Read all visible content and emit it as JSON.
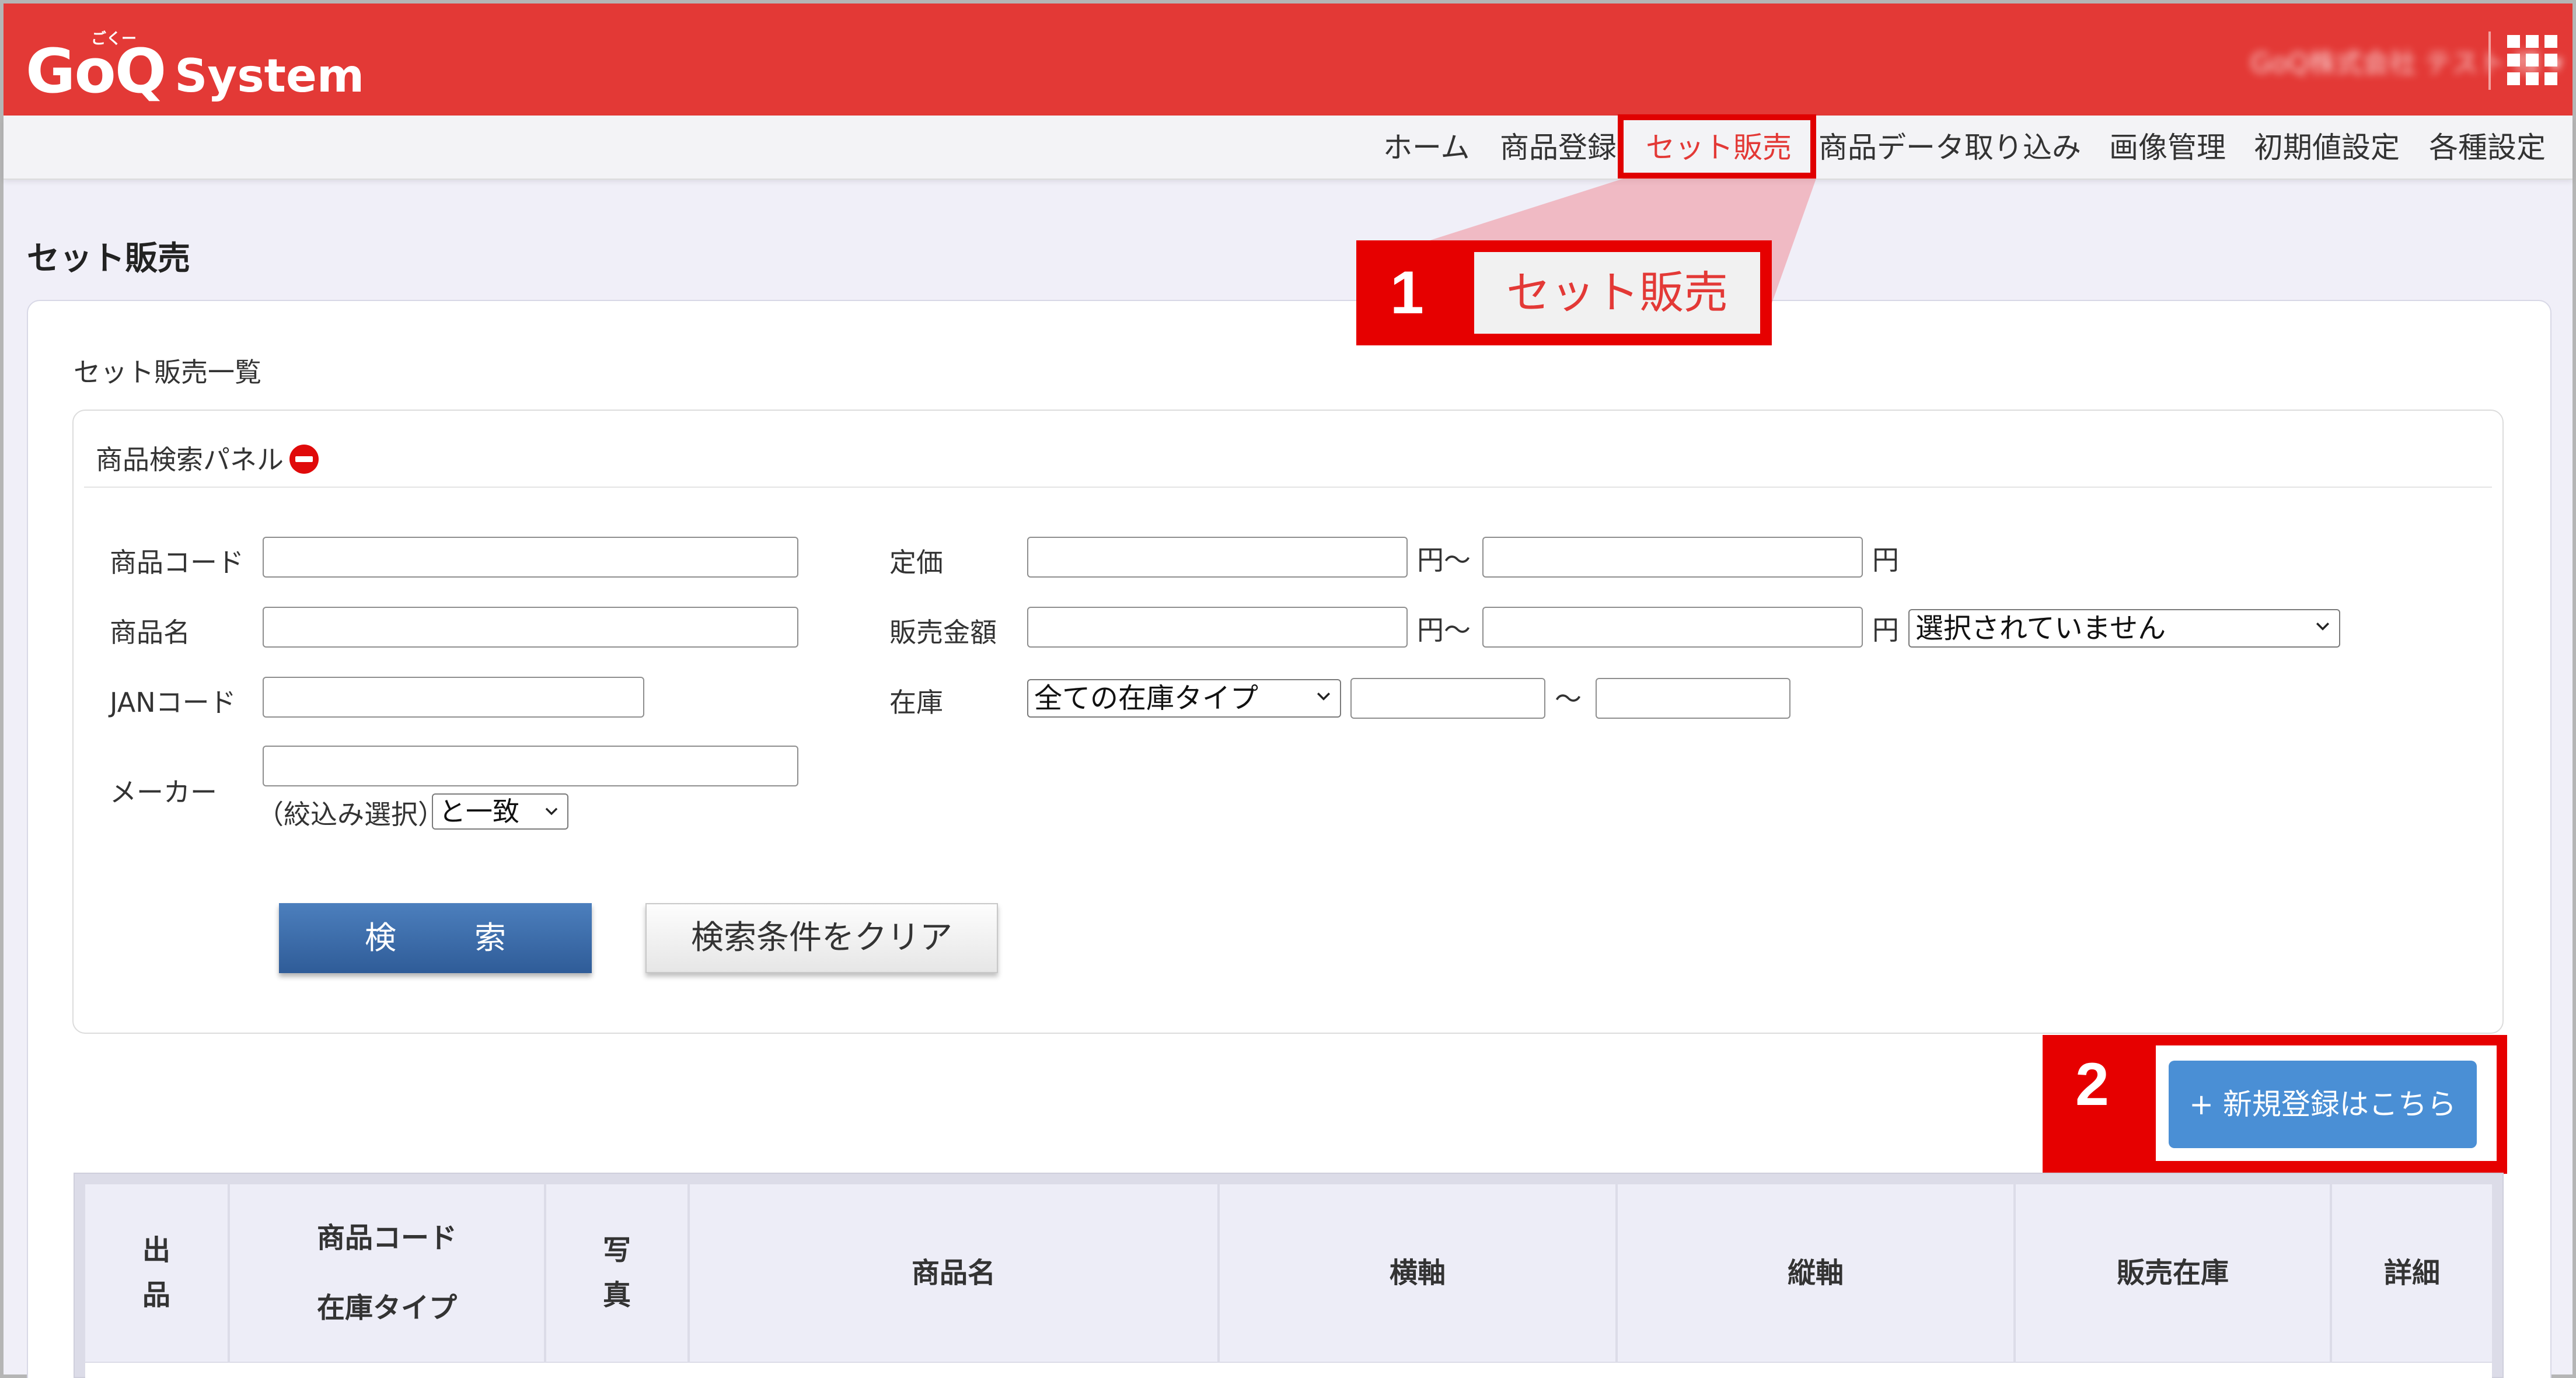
{
  "header": {
    "logo_main": "GoQ",
    "logo_sub": "System",
    "logo_furigana": "ごくー",
    "user_menu": "GoQ株式会社 テスト 様 ▾",
    "apps_icon": "grid-icon"
  },
  "nav": {
    "items": [
      "ホーム",
      "商品登録",
      "セット販売",
      "商品データ取り込み",
      "画像管理",
      "初期値設定",
      "各種設定"
    ],
    "active": "セット販売"
  },
  "callouts": {
    "step1_number": "1",
    "step1_label": "セット販売",
    "step2_number": "2"
  },
  "page": {
    "title": "セット販売",
    "list_title": "セット販売一覧"
  },
  "search_panel": {
    "title": "商品検索パネル",
    "collapse_icon": "minus-circle-icon",
    "fields": {
      "product_code_label": "商品コード",
      "product_name_label": "商品名",
      "jan_label": "JANコード",
      "maker_label": "メーカー",
      "maker_narrow_label": "（絞込み選択）",
      "maker_match_selected": "と一致",
      "list_price_label": "定価",
      "sale_price_label": "販売金額",
      "yen_tilde": "円〜",
      "yen": "円",
      "sale_price_select": "選択されていません",
      "stock_label": "在庫",
      "stock_type_selected": "全ての在庫タイプ",
      "tilde": "〜"
    },
    "search_button": "検　索",
    "clear_button": "検索条件をクリア"
  },
  "new_button": "+ 新規登録はこちら",
  "table": {
    "headers": [
      "出\n品",
      "商品コード\n在庫タイプ",
      "写\n真",
      "商品名",
      "横軸",
      "縦軸",
      "販売在庫",
      "詳細"
    ]
  },
  "colors": {
    "brand_red": "#e33936",
    "callout_red": "#e60000",
    "search_button_blue": "#3a6aa8",
    "new_button_blue": "#4a8fd5"
  }
}
